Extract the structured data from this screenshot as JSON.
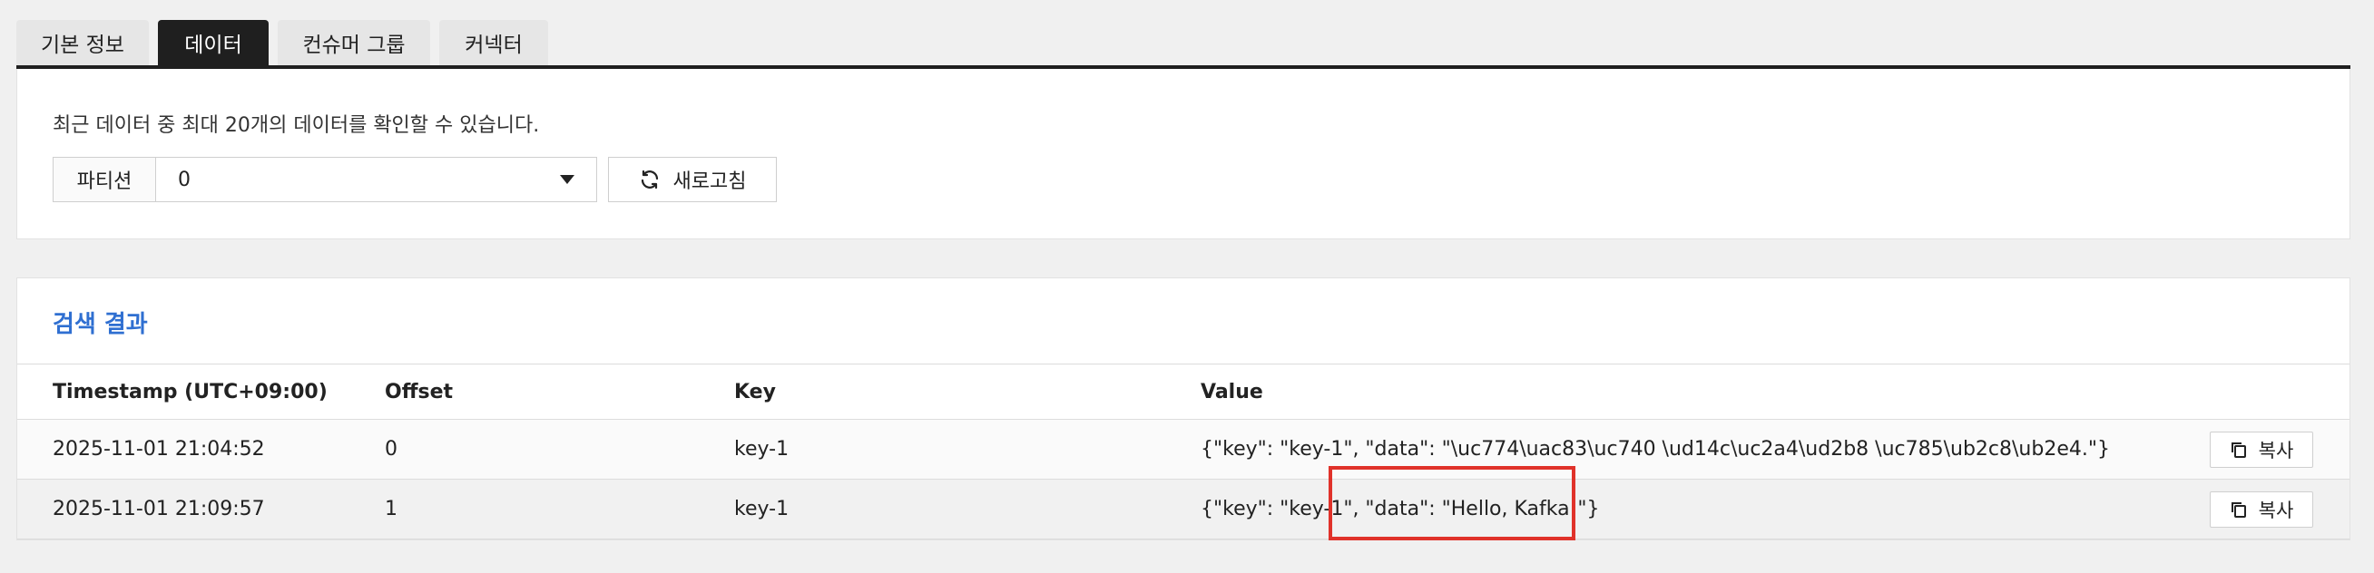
{
  "tabs": [
    {
      "label": "기본 정보",
      "active": false
    },
    {
      "label": "데이터",
      "active": true
    },
    {
      "label": "컨슈머 그룹",
      "active": false
    },
    {
      "label": "커넥터",
      "active": false
    }
  ],
  "filter": {
    "description": "최근 데이터 중 최대 20개의 데이터를 확인할 수 있습니다.",
    "partition_label": "파티션",
    "partition_value": "0",
    "refresh_label": "새로고침"
  },
  "results": {
    "title": "검색 결과",
    "columns": [
      "Timestamp (UTC+09:00)",
      "Offset",
      "Key",
      "Value"
    ],
    "rows": [
      {
        "timestamp": "2025-11-01 21:04:52",
        "offset": "0",
        "key": "key-1",
        "value": "{\"key\": \"key-1\", \"data\": \"\\uc774\\uac83\\uc740 \\ud14c\\uc2a4\\ud2b8 \\uc785\\ub2c8\\ub2e4.\"}",
        "copy_label": "복사"
      },
      {
        "timestamp": "2025-11-01 21:09:57",
        "offset": "1",
        "key": "key-1",
        "value": "{\"key\": \"key-1\", \"data\": \"Hello, Kafka!\"}",
        "copy_label": "복사"
      }
    ]
  },
  "colors": {
    "accent": "#2f6fd1",
    "active_tab": "#1f1f1f",
    "highlight": "#e0322a"
  }
}
